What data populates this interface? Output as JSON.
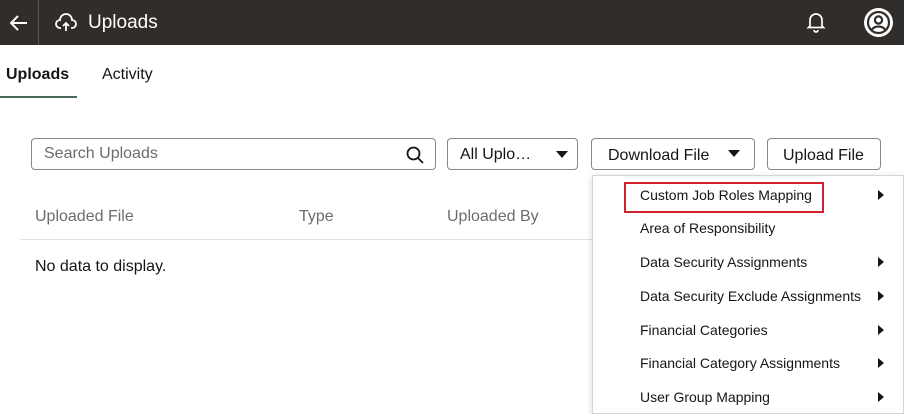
{
  "header": {
    "title": "Uploads",
    "back_icon": "arrow-left-icon",
    "app_icon": "cloud-upload-icon",
    "notification_icon": "bell-icon",
    "avatar_icon": "user-avatar-icon",
    "background_color": "#312d2a"
  },
  "tabs": [
    {
      "label": "Uploads",
      "selected": true
    },
    {
      "label": "Activity",
      "selected": false
    }
  ],
  "toolbar": {
    "search_placeholder": "Search Uploads",
    "search_value": "",
    "filter_selected": "All Uplo…",
    "download_label": "Download File",
    "upload_label": "Upload File"
  },
  "table": {
    "columns": [
      "Uploaded File",
      "Type",
      "Uploaded By"
    ],
    "empty_message": "No data to display."
  },
  "download_menu": {
    "items": [
      {
        "label": "Custom Job Roles Mapping",
        "has_submenu": true,
        "highlighted": true
      },
      {
        "label": "Area of Responsibility",
        "has_submenu": false
      },
      {
        "label": "Data Security Assignments",
        "has_submenu": true
      },
      {
        "label": "Data Security Exclude Assignments",
        "has_submenu": true
      },
      {
        "label": "Financial Categories",
        "has_submenu": true
      },
      {
        "label": "Financial Category Assignments",
        "has_submenu": true
      },
      {
        "label": "User Group Mapping",
        "has_submenu": true
      }
    ],
    "highlight_color": "#d0222b"
  },
  "colors": {
    "tab_underline": "#4b6b59",
    "text_primary": "#161513",
    "text_secondary": "#6f6b68"
  }
}
